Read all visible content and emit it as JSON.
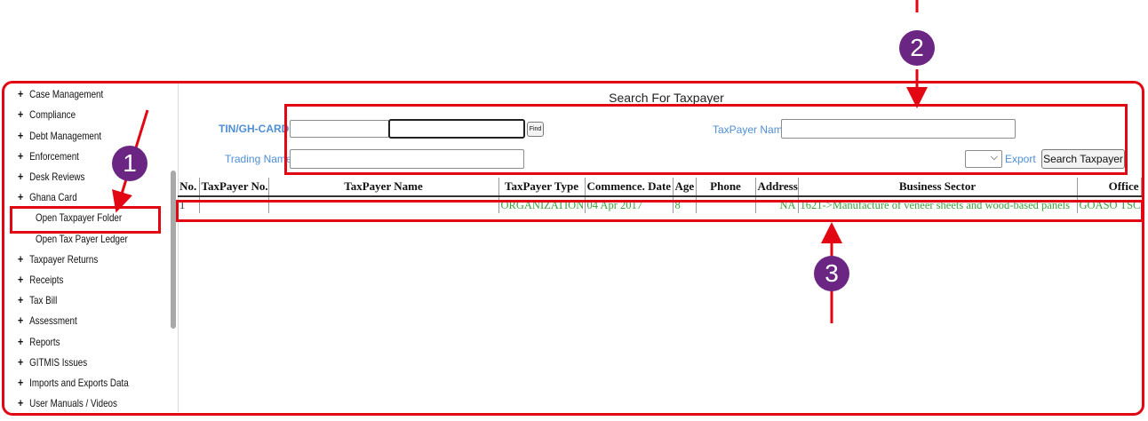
{
  "sidebar": {
    "items": [
      {
        "label": "Case Management",
        "expandable": true
      },
      {
        "label": "Compliance",
        "expandable": true
      },
      {
        "label": "Debt Management",
        "expandable": true
      },
      {
        "label": "Enforcement",
        "expandable": true
      },
      {
        "label": "Desk Reviews",
        "expandable": true
      },
      {
        "label": "Ghana Card",
        "expandable": true
      },
      {
        "label": "Open Taxpayer Folder",
        "expandable": false
      },
      {
        "label": "Open Tax Payer Ledger",
        "expandable": false
      },
      {
        "label": "Taxpayer Returns",
        "expandable": true
      },
      {
        "label": "Receipts",
        "expandable": true
      },
      {
        "label": "Tax Bill",
        "expandable": true
      },
      {
        "label": "Assessment",
        "expandable": true
      },
      {
        "label": "Reports",
        "expandable": true
      },
      {
        "label": "GITMIS Issues",
        "expandable": true
      },
      {
        "label": "Imports and Exports Data",
        "expandable": true
      },
      {
        "label": "User Manuals / Videos",
        "expandable": true
      }
    ],
    "plus_symbol": "+"
  },
  "search": {
    "title": "Search For Taxpayer",
    "tin_label": "TIN/GH-CARD",
    "tin_value": "",
    "ghcard_value": "",
    "find_label": "Find",
    "taxpayer_name_label": "TaxPayer Name",
    "taxpayer_name_value": "",
    "trading_name_label": "Trading Name",
    "trading_name_value": "",
    "export_select_value": "",
    "export_label": "Export",
    "search_button_label": "Search Taxpayer"
  },
  "table": {
    "headers": [
      "No.",
      "TaxPayer No.",
      "TaxPayer Name",
      "TaxPayer Type",
      "Commence. Date",
      "Age",
      "Phone",
      "Address",
      "Business Sector",
      "Office"
    ],
    "rows": [
      [
        "1",
        "",
        "",
        "ORGANIZATION",
        "04 Apr 2017",
        "8",
        "",
        "NA",
        "1621->Manufacture of veneer sheets and wood-based panels",
        "GOASO TSC"
      ]
    ]
  },
  "annotations": {
    "markers": [
      "1",
      "2",
      "3"
    ]
  },
  "colors": {
    "annotation_red": "#e30613",
    "marker_purple": "#6b2683",
    "label_blue": "#4e8fd6",
    "row_green": "#3aa03a"
  }
}
